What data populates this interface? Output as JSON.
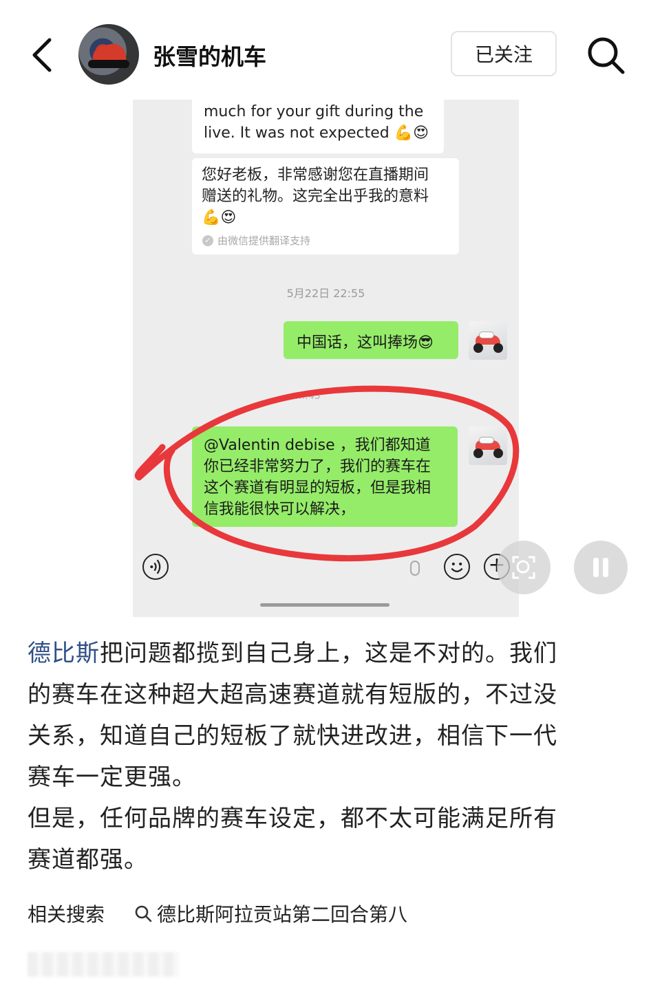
{
  "header": {
    "account_name": "张雪的机车",
    "follow_label": "已关注"
  },
  "chat": {
    "msg_en_lines": [
      "much for your gift during the",
      "live. It was not expected 💪😍"
    ],
    "msg_cn_lines": [
      "您好老板，非常感谢您在直播期间",
      "赠送的礼物。这完全出乎我的意料",
      "💪😍"
    ],
    "translation_note": "由微信提供翻译支持",
    "timestamp_1": "5月22日 22:55",
    "timestamp_2": "…:43",
    "my_msg_1": "中国话，这叫捧场😎",
    "my_msg_2_lines": [
      "@Valentin debise ，我们都知道",
      "你已经非常努力了，我们的赛车在",
      "这个赛道有明显的短板，但是我相",
      "信我能很快可以解决，"
    ]
  },
  "post": {
    "tag": "德比斯",
    "line1_rest": "把问题都揽到自己身上，这是不对的。我们",
    "line2": "的赛车在这种超大超高速赛道就有短版的，不过没",
    "line3": "关系，知道自己的短板了就快进改进，相信下一代",
    "line4": "赛车一定更强。",
    "line5": "但是，任何品牌的赛车设定，都不太可能满足所有",
    "line6": "赛道都强。"
  },
  "related": {
    "label": "相关搜索",
    "query": "德比斯阿拉贡站第二回合第八"
  },
  "colors": {
    "wechat_green": "#95ec69",
    "annotation_red": "#e8383b",
    "tag_blue": "#2f4f86"
  },
  "icons": [
    "back-arrow-icon",
    "search-icon",
    "voice-icon",
    "mic-icon",
    "emoji-icon",
    "plus-icon",
    "scan-icon",
    "pause-icon"
  ]
}
